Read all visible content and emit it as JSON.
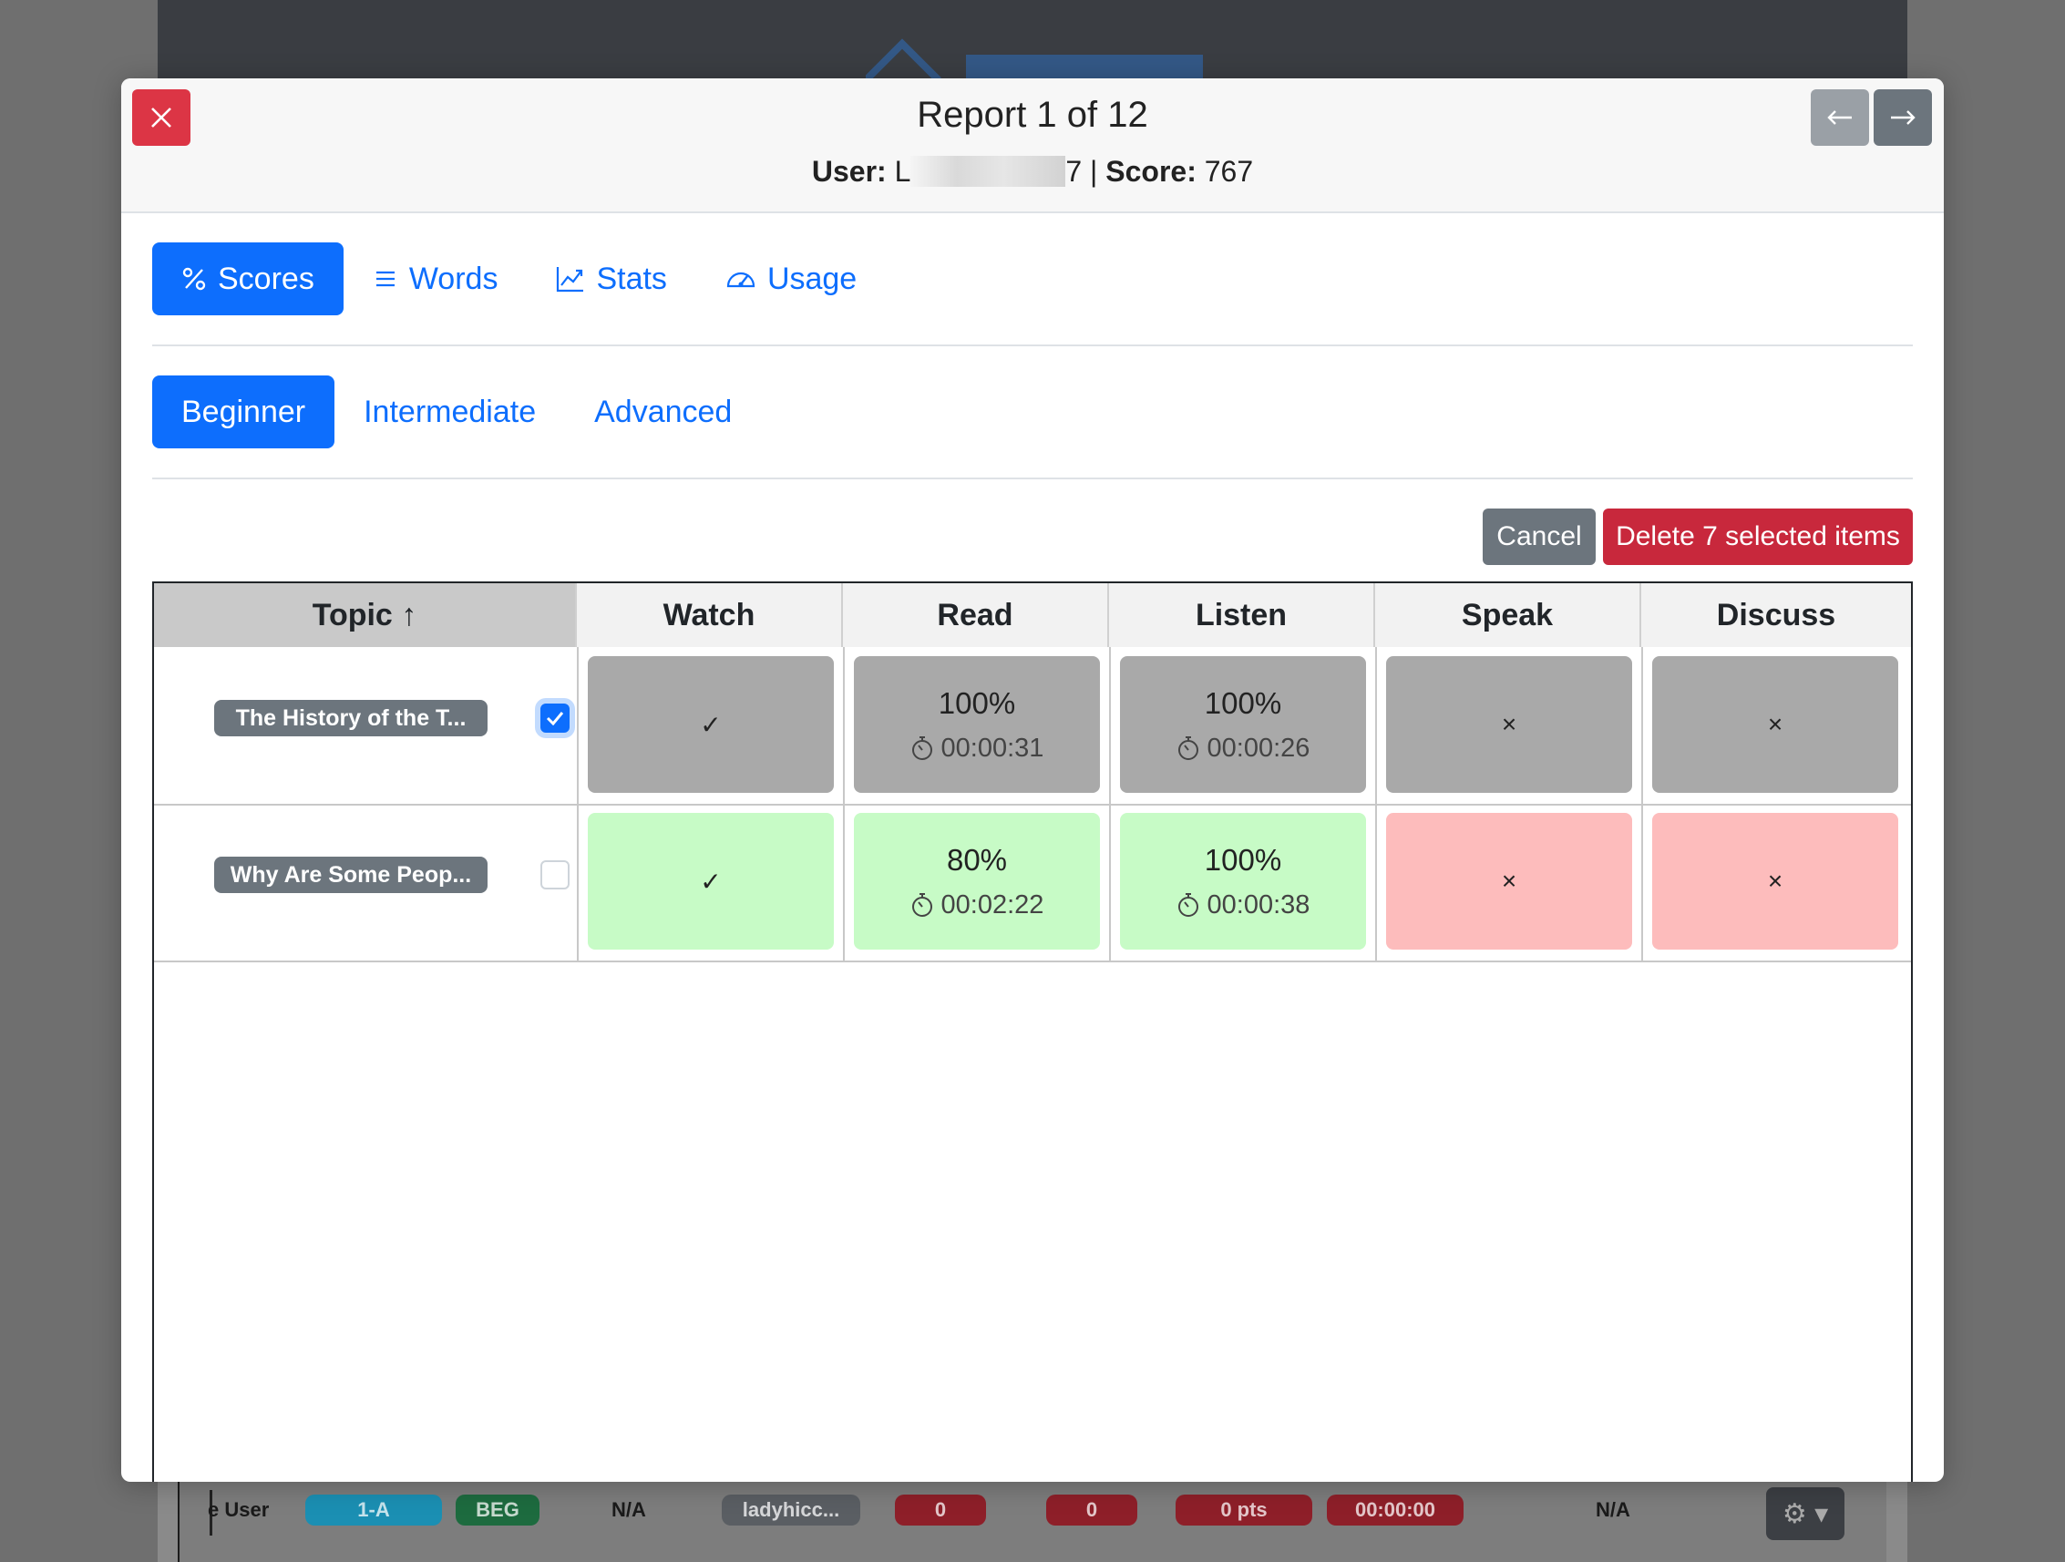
{
  "background": {
    "row": {
      "user_text": "e User",
      "class_badge": "1-A",
      "level_badge": "BEG",
      "na1": "N/A",
      "username": "ladyhicc...",
      "val1": "0",
      "val2": "0",
      "pts": "0 pts",
      "time": "00:00:00",
      "na2": "N/A"
    }
  },
  "modal": {
    "title": "Report 1 of 12",
    "user_label": "User:",
    "user_prefix": "L",
    "user_suffix": "7",
    "separator": "|",
    "score_label": "Score:",
    "score_value": "767"
  },
  "main_tabs": [
    {
      "label": "Scores",
      "icon": "percent-icon",
      "active": true
    },
    {
      "label": "Words",
      "icon": "list-icon",
      "active": false
    },
    {
      "label": "Stats",
      "icon": "line-chart-icon",
      "active": false
    },
    {
      "label": "Usage",
      "icon": "speedometer-icon",
      "active": false
    }
  ],
  "level_tabs": [
    {
      "label": "Beginner",
      "active": true
    },
    {
      "label": "Intermediate",
      "active": false
    },
    {
      "label": "Advanced",
      "active": false
    }
  ],
  "actions": {
    "cancel": "Cancel",
    "delete": "Delete 7 selected items"
  },
  "table": {
    "headers": [
      "Topic ↑",
      "Watch",
      "Read",
      "Listen",
      "Speak",
      "Discuss"
    ],
    "rows": [
      {
        "topic": "The History of the T...",
        "checked": true,
        "watch": "✓",
        "read_pct": "100%",
        "read_time": "00:00:31",
        "listen_pct": "100%",
        "listen_time": "00:00:26",
        "speak": "×",
        "discuss": "×"
      },
      {
        "topic": "Why Are Some Peop...",
        "checked": false,
        "watch": "✓",
        "read_pct": "80%",
        "read_time": "00:02:22",
        "listen_pct": "100%",
        "listen_time": "00:00:38",
        "speak": "×",
        "discuss": "×"
      }
    ]
  },
  "colors": {
    "primary": "#0d6efd",
    "danger": "#dc3545",
    "secondary": "#6c757d",
    "cell_gray": "#a9a9a9",
    "cell_green": "#c7fbc6",
    "cell_red": "#fdbcbc"
  }
}
